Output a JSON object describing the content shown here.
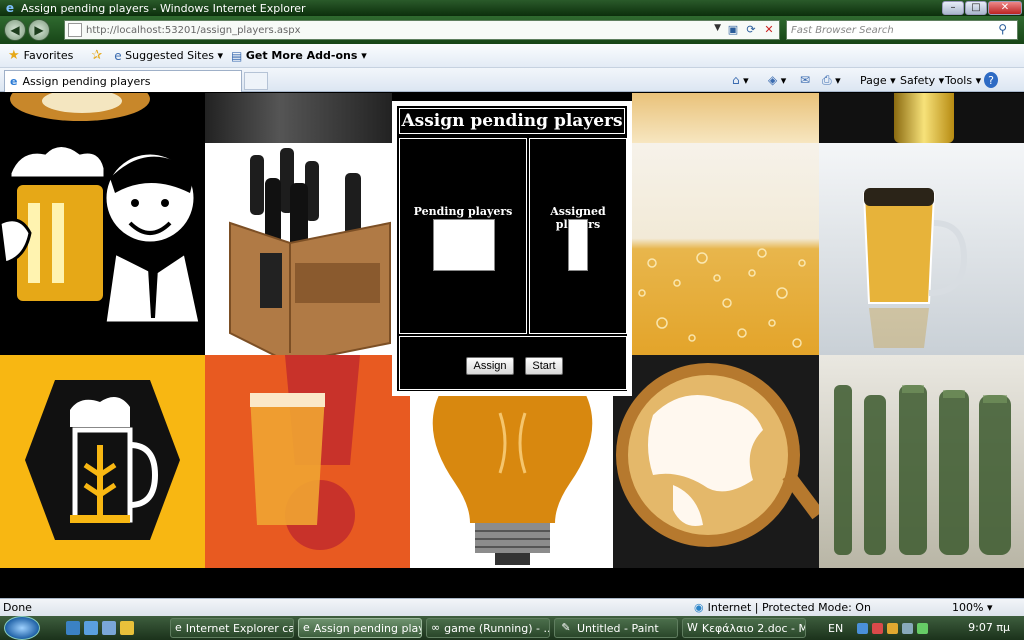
{
  "window": {
    "title": "Assign pending players - Windows Internet Explorer",
    "min": "–",
    "max": "□",
    "close": "✕"
  },
  "address": {
    "url": "http://localhost:53201/assign_players.aspx",
    "search_placeholder": "Fast Browser Search"
  },
  "favorites": {
    "favorites_label": "Favorites",
    "suggested_label": "Suggested Sites ▾",
    "addons_label": "Get More Add-ons ▾"
  },
  "tabs": [
    {
      "label": "Assign pending players"
    }
  ],
  "command_bar": {
    "page": "Page ▾",
    "safety": "Safety ▾",
    "tools": "Tools ▾",
    "help": "?"
  },
  "dialog": {
    "title": "Assign pending players",
    "pending_label": "Pending players",
    "assigned_label": "Assigned players",
    "assign_button": "Assign",
    "start_button": "Start"
  },
  "status": {
    "text": "Done",
    "zone": "Internet | Protected Mode: On",
    "zoom": "100% ▾"
  },
  "taskbar": {
    "items": [
      {
        "label": "Internet Explorer ca..."
      },
      {
        "label": "Assign pending play..."
      },
      {
        "label": "game (Running) - ..."
      },
      {
        "label": "Untitled - Paint"
      },
      {
        "label": "Κεφάλαιο 2.doc - M..."
      }
    ],
    "lang": "EN",
    "clock": "9:07 πμ"
  },
  "colors": {
    "dialog_bg": "#000000",
    "dialog_border": "#ffffff",
    "chrome_green": "#174517"
  }
}
